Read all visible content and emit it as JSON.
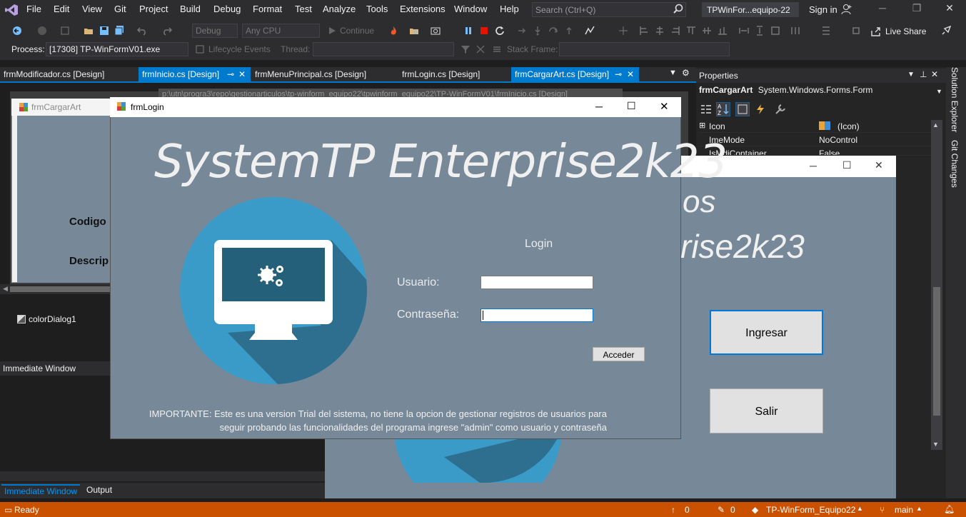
{
  "menubar": {
    "items": [
      "File",
      "Edit",
      "View",
      "Git",
      "Project",
      "Build",
      "Debug",
      "Format",
      "Test",
      "Analyze",
      "Tools",
      "Extensions",
      "Window",
      "Help"
    ],
    "search_placeholder": "Search (Ctrl+Q)",
    "solution_name": "TPWinFor...equipo-22",
    "sign_in": "Sign in"
  },
  "toolbar": {
    "config": "Debug",
    "platform": "Any CPU",
    "continue": "Continue",
    "live_share": "Live Share"
  },
  "toolbar2": {
    "process_label": "Process:",
    "process_value": "[17308] TP-WinFormV01.exe",
    "lifecycle": "Lifecycle Events",
    "thread_label": "Thread:",
    "stack_frame_label": "Stack Frame:"
  },
  "tabs": [
    {
      "label": "frmModificador.cs [Design]",
      "active": false
    },
    {
      "label": "frmInicio.cs [Design]",
      "active": true
    },
    {
      "label": "frmMenuPrincipal.cs [Design]",
      "active": false
    },
    {
      "label": "frmLogin.cs [Design]",
      "active": false
    },
    {
      "label": "frmCargarArt.cs [Design]",
      "active": true
    }
  ],
  "designer": {
    "path_tooltip": "p:\\utn\\progra3\\repo\\gestionarticulos\\tp-winform_equipo22\\tpwinform_equipo22\\TP-WinFormV01\\frmInicio.cs [Design]",
    "cargar_title": "frmCargarArt",
    "label_codigo": "Codigo",
    "label_descrip": "Descrip",
    "tray_component": "colorDialog1"
  },
  "immediate": {
    "title": "Immediate Window",
    "tabs": [
      "Immediate Window",
      "Output"
    ]
  },
  "properties": {
    "title": "Properties",
    "object_name": "frmCargarArt",
    "object_type": "System.Windows.Forms.Form",
    "rows": [
      {
        "name": "Icon",
        "value": "(Icon)"
      },
      {
        "name": "ImeMode",
        "value": "NoControl"
      },
      {
        "name": "IsMdiContainer",
        "value": "False"
      }
    ]
  },
  "side_tabs": [
    "Solution Explorer",
    "Git Changes"
  ],
  "mainform": {
    "heading_line1": "os",
    "heading_line2": "rise2k23",
    "btn_ingresar": "Ingresar",
    "btn_salir": "Salir"
  },
  "login": {
    "window_title": "frmLogin",
    "heading": "SystemTP Enterprise2k23",
    "subtitle": "Login",
    "user_label": "Usuario:",
    "password_label": "Contraseña:",
    "user_value": "",
    "password_value": "",
    "submit": "Acceder",
    "notice_line1": "IMPORTANTE: Este es una version Trial del sistema, no tiene la opcion de gestionar registros de usuarios para",
    "notice_line2": "seguir probando las funcionalidades del programa ingrese \"admin\" como usuario y contraseña"
  },
  "statusbar": {
    "ready": "Ready",
    "up_count": "0",
    "pencil_count": "0",
    "repo": "TP-WinForm_Equipo22",
    "branch": "main"
  },
  "colors": {
    "accent": "#007acc",
    "status": "#ca5100",
    "form_bg": "#778899",
    "circle": "#3a9bc8",
    "circle_shadow": "#2e6e8e"
  }
}
